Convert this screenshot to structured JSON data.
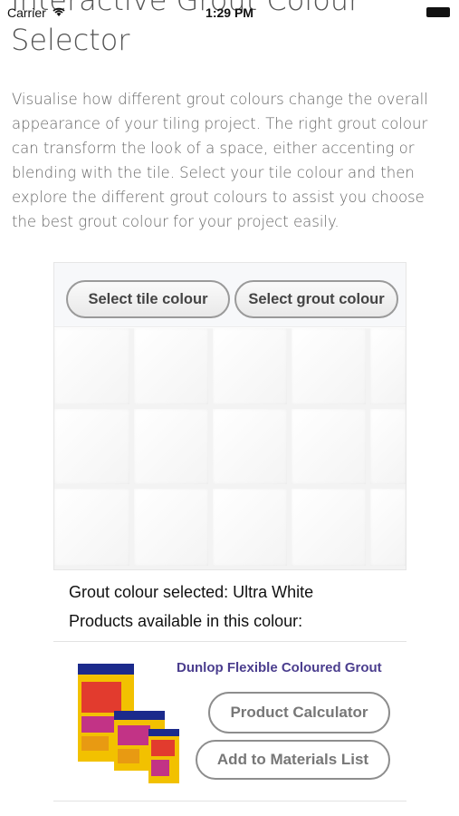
{
  "status_bar": {
    "carrier": "Carrier",
    "time": "1:29 PM"
  },
  "page": {
    "title": "Interactive Grout Colour Selector",
    "intro": "Visualise how different grout colours change the overall appearance of your tiling project. The right grout colour can transform the look of a space, either accenting or blending with the tile. Select your tile colour and then explore the different grout colours to assist you choose the best grout colour for your project easily."
  },
  "selector": {
    "tile_button": "Select tile colour",
    "grout_button": "Select grout colour"
  },
  "result": {
    "grout_selected": "Grout colour selected: Ultra White",
    "products_label": "Products available in this colour:"
  },
  "product": {
    "name": "Dunlop Flexible Coloured Grout",
    "calculator_button": "Product Calculator",
    "materials_button": "Add to Materials List"
  }
}
